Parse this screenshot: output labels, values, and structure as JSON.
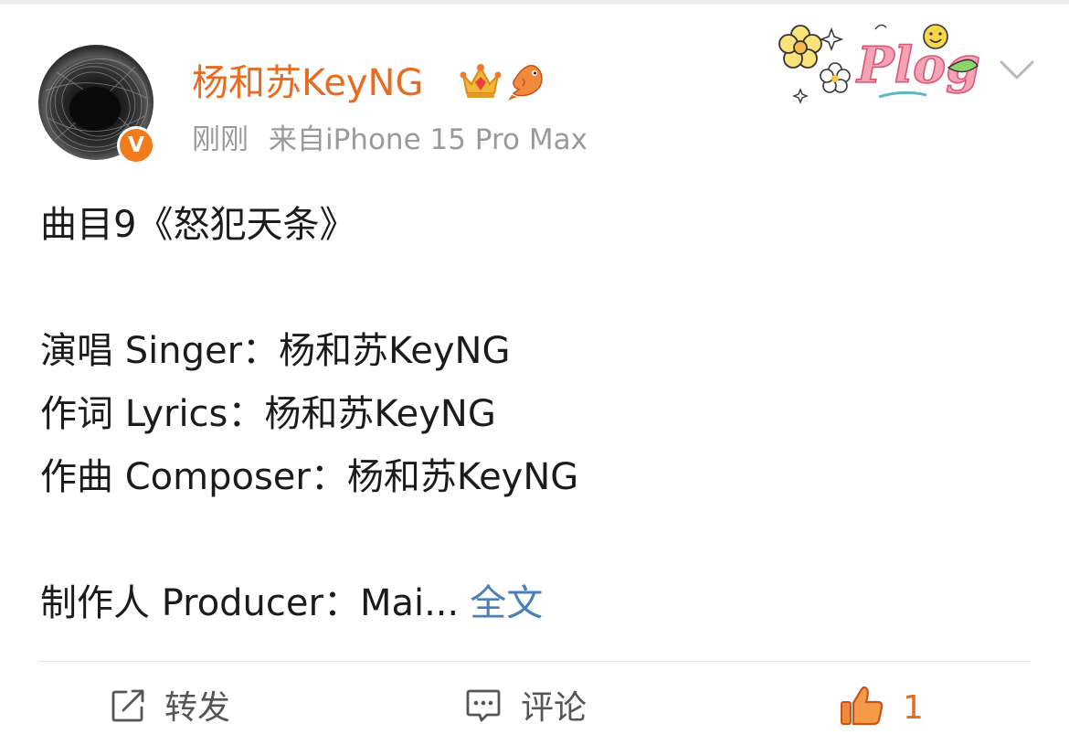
{
  "post": {
    "author": "杨和苏KeyNG",
    "time": "刚刚",
    "source": "来自iPhone 15 Pro Max",
    "badge": "V",
    "sticker_text": "Plog",
    "lines": [
      "曲目9《怒犯天条》",
      "",
      "演唱 Singer：杨和苏KeyNG",
      "作词 Lyrics：杨和苏KeyNG",
      "作曲 Composer：杨和苏KeyNG",
      "",
      "制作人 Producer：Mai..."
    ],
    "full_text_link": "全文"
  },
  "actions": {
    "repost_label": "转发",
    "comment_label": "评论",
    "like_count": "1"
  },
  "colors": {
    "username": "#e86b1f",
    "link": "#4a7fb8",
    "meta": "#9a9a9a",
    "like": "#e86b1f"
  },
  "icons": [
    "v-badge-icon",
    "crown-icon",
    "fish-icon",
    "plog-sticker-icon",
    "chevron-down-icon",
    "repost-icon",
    "comment-icon",
    "thumbs-up-icon"
  ]
}
